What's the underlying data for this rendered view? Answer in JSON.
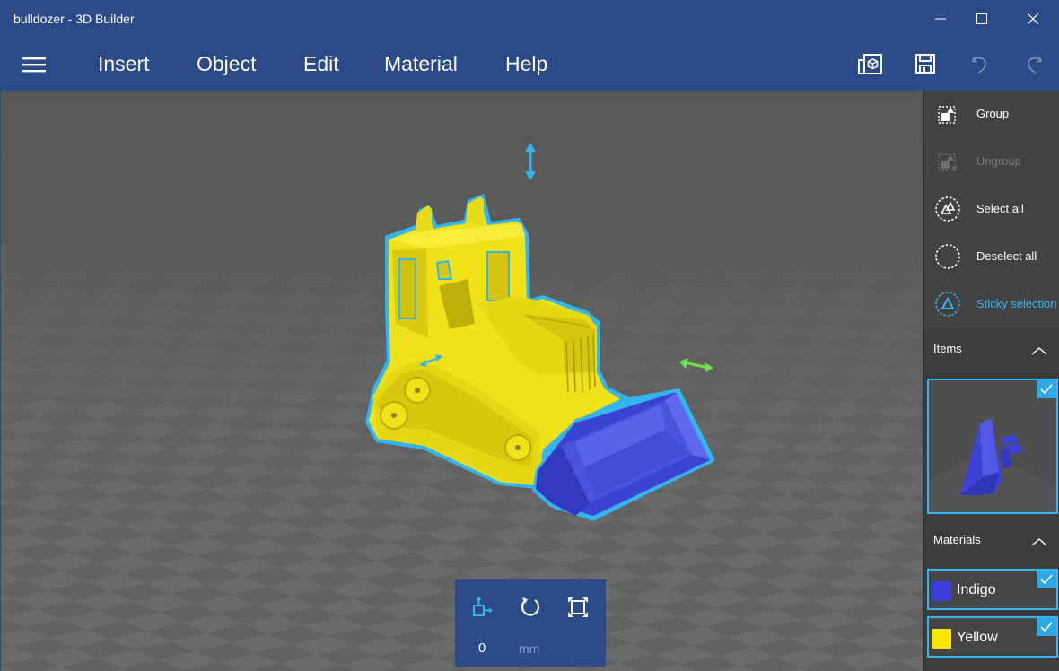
{
  "window": {
    "title": "bulldozer - 3D Builder",
    "controls": {
      "minimize": "minimize-icon",
      "maximize": "maximize-icon",
      "close": "close-icon"
    }
  },
  "menubar": {
    "hamburger_icon": "hamburger-icon",
    "items": [
      {
        "label": "Insert"
      },
      {
        "label": "Object"
      },
      {
        "label": "Edit"
      },
      {
        "label": "Material"
      },
      {
        "label": "Help"
      }
    ],
    "toolbar_icons": [
      "3d-view-icon",
      "save-icon",
      "undo-icon",
      "redo-icon"
    ]
  },
  "panel": {
    "actions": [
      {
        "label": "Group",
        "icon": "group-icon",
        "state": "enabled"
      },
      {
        "label": "Ungroup",
        "icon": "ungroup-icon",
        "state": "disabled"
      },
      {
        "label": "Select all",
        "icon": "select-all-icon",
        "state": "enabled"
      },
      {
        "label": "Deselect all",
        "icon": "deselect-all-icon",
        "state": "enabled"
      },
      {
        "label": "Sticky selection",
        "icon": "sticky-selection-icon",
        "state": "active"
      }
    ],
    "items_section": {
      "label": "Items",
      "expanded": true,
      "item_selected": true
    },
    "materials_section": {
      "label": "Materials",
      "expanded": true,
      "materials": [
        {
          "name": "Indigo",
          "color": "#3b3fd6",
          "selected": true
        },
        {
          "name": "Yellow",
          "color": "#f7e600",
          "selected": true
        }
      ]
    }
  },
  "viewport": {
    "object": "bulldozer",
    "selection_color": "#35b5f0",
    "body_color": "#f0e41c",
    "bucket_color": "#3c42d4",
    "gizmo_vertical_color": "#35b5f0",
    "gizmo_horizontal_color": "#6ce14a"
  },
  "toolbox": {
    "tools": [
      "move-icon",
      "rotate-icon",
      "scale-icon"
    ],
    "active_tool": "move",
    "value": "0",
    "unit": "mm"
  },
  "colors": {
    "chrome": "#2b4a8a",
    "panel": "#3c3c3c",
    "accent": "#35b5f0"
  }
}
